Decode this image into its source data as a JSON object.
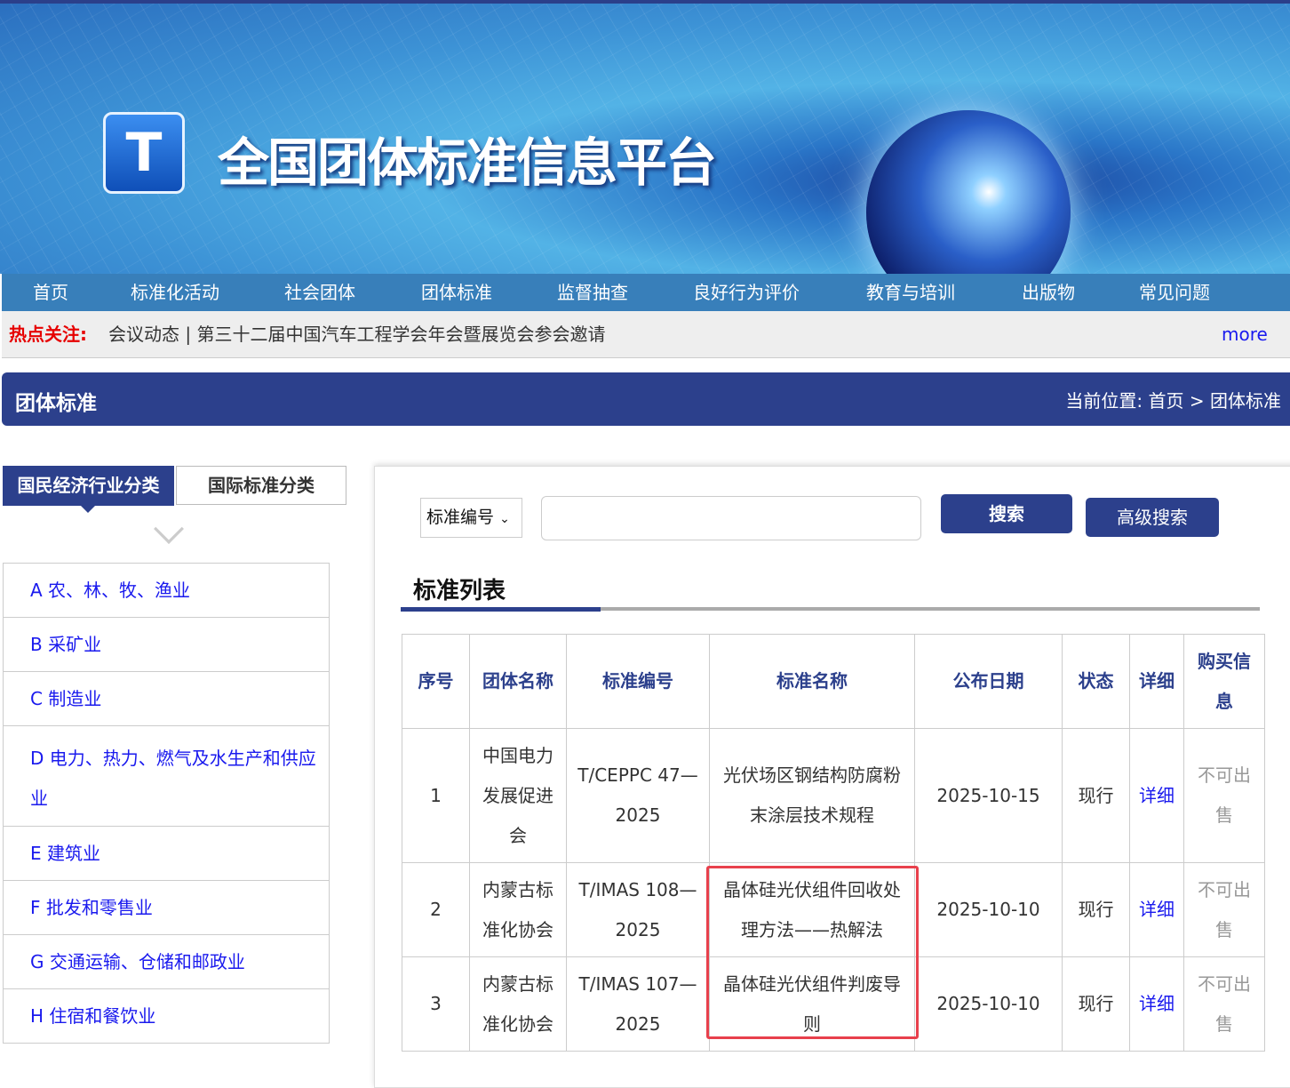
{
  "header": {
    "site_title": "全国团体标准信息平台"
  },
  "nav": [
    "首页",
    "标准化活动",
    "社会团体",
    "团体标准",
    "监督抽查",
    "良好行为评价",
    "教育与培训",
    "出版物",
    "常见问题"
  ],
  "hot": {
    "label": "热点关注:",
    "text": "会议动态 | 第三十二届中国汽车工程学会年会暨展览会参会邀请",
    "more": "more"
  },
  "section": {
    "title": "团体标准",
    "crumb": "当前位置: 首页 > 团体标准"
  },
  "tabs": [
    "国民经济行业分类",
    "国际标准分类"
  ],
  "categories": [
    "A 农、林、牧、渔业",
    "B 采矿业",
    "C 制造业",
    "D 电力、热力、燃气及水生产和供应业",
    "E 建筑业",
    "F 批发和零售业",
    "G 交通运输、仓储和邮政业",
    "H 住宿和餐饮业"
  ],
  "search": {
    "select": "标准编号",
    "search_btn": "搜索",
    "adv_btn": "高级搜索",
    "input_value": ""
  },
  "list_title": "标准列表",
  "table": {
    "headers": [
      "序号",
      "团体名称",
      "标准编号",
      "标准名称",
      "公布日期",
      "状态",
      "详细",
      "购买信息"
    ],
    "rows": [
      [
        "1",
        "中国电力发展促进会",
        "T/CEPPC 47—2025",
        "光伏场区钢结构防腐粉末涂层技术规程",
        "2025-10-15",
        "现行",
        "详细",
        "不可出售"
      ],
      [
        "2",
        "内蒙古标准化协会",
        "T/IMAS 108—2025",
        "晶体硅光伏组件回收处理方法——热解法",
        "2025-10-10",
        "现行",
        "详细",
        "不可出售"
      ],
      [
        "3",
        "内蒙古标准化协会",
        "T/IMAS 107—2025",
        "晶体硅光伏组件判废导则",
        "2025-10-10",
        "现行",
        "详细",
        "不可出售"
      ]
    ]
  }
}
